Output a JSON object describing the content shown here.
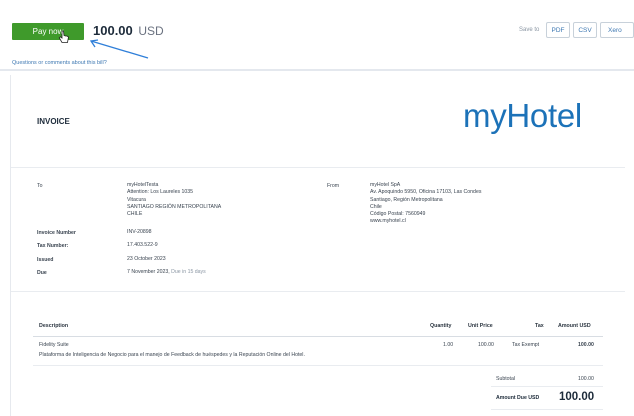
{
  "toolbar": {
    "pay_label": "Pay now",
    "amount": "100.00",
    "currency": "USD",
    "save_to_label": "Save to",
    "save_options": [
      "PDF",
      "CSV",
      "Xero"
    ]
  },
  "questions_link": "Questions or comments about this bill?",
  "invoice": {
    "title": "INVOICE",
    "logo": "myHotel",
    "to_label": "To",
    "to_lines": [
      "myHotelTesta",
      "Attention: Los Laureles 1035",
      "Vitacura",
      "SANTIAGO REGIÓN METROPOLITANA",
      "CHILE"
    ],
    "from_label": "From",
    "from_lines": [
      "myHotel SpA",
      "Av. Apoquindo 5950, Oficina 17103, Las Condes",
      "Santiago, Región Metropolitana",
      "Chile",
      "Código Postal: 7560949",
      "www.myhotel.cl"
    ],
    "fields": [
      {
        "label": "Invoice Number",
        "value": "INV-20898"
      },
      {
        "label": "Tax Number:",
        "value": "17.403.522-9"
      },
      {
        "label": "Issued",
        "value": "23 October 2023"
      },
      {
        "label": "Due",
        "value": "7 November 2023,",
        "note": "Due in 15 days"
      }
    ]
  },
  "table": {
    "headers": [
      "Description",
      "Quantity",
      "Unit Price",
      "Tax",
      "Amount USD"
    ],
    "rows": [
      {
        "title": "Fidelity Suite",
        "detail": "Plataforma de Inteligencia de Negocio para el manejo de Feedback de huéspedes y la Reputación Online del Hotel.",
        "quantity": "1.00",
        "unit_price": "100.00",
        "tax": "Tax Exempt",
        "amount": "100.00"
      }
    ],
    "subtotal_label": "Subtotal",
    "subtotal_value": "100.00",
    "total_label": "Amount Due USD",
    "total_value": "100.00"
  },
  "colors": {
    "pay_button": "#3f9a2b",
    "link": "#3e78b2",
    "logo": "#1c72b8"
  }
}
